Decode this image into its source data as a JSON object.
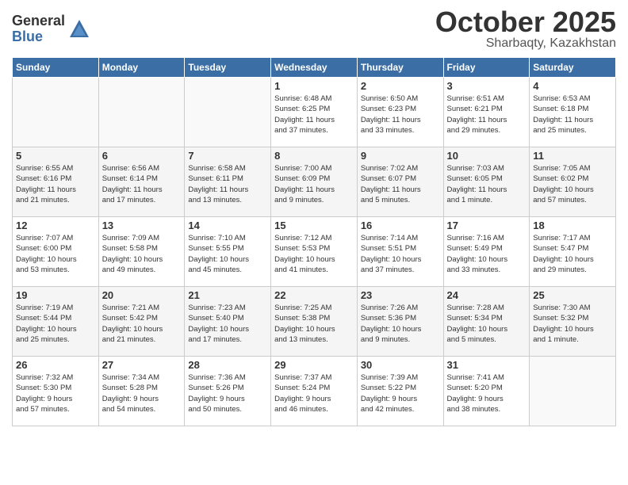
{
  "logo": {
    "general": "General",
    "blue": "Blue"
  },
  "header": {
    "month": "October 2025",
    "location": "Sharbaqty, Kazakhstan"
  },
  "weekdays": [
    "Sunday",
    "Monday",
    "Tuesday",
    "Wednesday",
    "Thursday",
    "Friday",
    "Saturday"
  ],
  "weeks": [
    [
      {
        "day": "",
        "info": ""
      },
      {
        "day": "",
        "info": ""
      },
      {
        "day": "",
        "info": ""
      },
      {
        "day": "1",
        "info": "Sunrise: 6:48 AM\nSunset: 6:25 PM\nDaylight: 11 hours\nand 37 minutes."
      },
      {
        "day": "2",
        "info": "Sunrise: 6:50 AM\nSunset: 6:23 PM\nDaylight: 11 hours\nand 33 minutes."
      },
      {
        "day": "3",
        "info": "Sunrise: 6:51 AM\nSunset: 6:21 PM\nDaylight: 11 hours\nand 29 minutes."
      },
      {
        "day": "4",
        "info": "Sunrise: 6:53 AM\nSunset: 6:18 PM\nDaylight: 11 hours\nand 25 minutes."
      }
    ],
    [
      {
        "day": "5",
        "info": "Sunrise: 6:55 AM\nSunset: 6:16 PM\nDaylight: 11 hours\nand 21 minutes."
      },
      {
        "day": "6",
        "info": "Sunrise: 6:56 AM\nSunset: 6:14 PM\nDaylight: 11 hours\nand 17 minutes."
      },
      {
        "day": "7",
        "info": "Sunrise: 6:58 AM\nSunset: 6:11 PM\nDaylight: 11 hours\nand 13 minutes."
      },
      {
        "day": "8",
        "info": "Sunrise: 7:00 AM\nSunset: 6:09 PM\nDaylight: 11 hours\nand 9 minutes."
      },
      {
        "day": "9",
        "info": "Sunrise: 7:02 AM\nSunset: 6:07 PM\nDaylight: 11 hours\nand 5 minutes."
      },
      {
        "day": "10",
        "info": "Sunrise: 7:03 AM\nSunset: 6:05 PM\nDaylight: 11 hours\nand 1 minute."
      },
      {
        "day": "11",
        "info": "Sunrise: 7:05 AM\nSunset: 6:02 PM\nDaylight: 10 hours\nand 57 minutes."
      }
    ],
    [
      {
        "day": "12",
        "info": "Sunrise: 7:07 AM\nSunset: 6:00 PM\nDaylight: 10 hours\nand 53 minutes."
      },
      {
        "day": "13",
        "info": "Sunrise: 7:09 AM\nSunset: 5:58 PM\nDaylight: 10 hours\nand 49 minutes."
      },
      {
        "day": "14",
        "info": "Sunrise: 7:10 AM\nSunset: 5:55 PM\nDaylight: 10 hours\nand 45 minutes."
      },
      {
        "day": "15",
        "info": "Sunrise: 7:12 AM\nSunset: 5:53 PM\nDaylight: 10 hours\nand 41 minutes."
      },
      {
        "day": "16",
        "info": "Sunrise: 7:14 AM\nSunset: 5:51 PM\nDaylight: 10 hours\nand 37 minutes."
      },
      {
        "day": "17",
        "info": "Sunrise: 7:16 AM\nSunset: 5:49 PM\nDaylight: 10 hours\nand 33 minutes."
      },
      {
        "day": "18",
        "info": "Sunrise: 7:17 AM\nSunset: 5:47 PM\nDaylight: 10 hours\nand 29 minutes."
      }
    ],
    [
      {
        "day": "19",
        "info": "Sunrise: 7:19 AM\nSunset: 5:44 PM\nDaylight: 10 hours\nand 25 minutes."
      },
      {
        "day": "20",
        "info": "Sunrise: 7:21 AM\nSunset: 5:42 PM\nDaylight: 10 hours\nand 21 minutes."
      },
      {
        "day": "21",
        "info": "Sunrise: 7:23 AM\nSunset: 5:40 PM\nDaylight: 10 hours\nand 17 minutes."
      },
      {
        "day": "22",
        "info": "Sunrise: 7:25 AM\nSunset: 5:38 PM\nDaylight: 10 hours\nand 13 minutes."
      },
      {
        "day": "23",
        "info": "Sunrise: 7:26 AM\nSunset: 5:36 PM\nDaylight: 10 hours\nand 9 minutes."
      },
      {
        "day": "24",
        "info": "Sunrise: 7:28 AM\nSunset: 5:34 PM\nDaylight: 10 hours\nand 5 minutes."
      },
      {
        "day": "25",
        "info": "Sunrise: 7:30 AM\nSunset: 5:32 PM\nDaylight: 10 hours\nand 1 minute."
      }
    ],
    [
      {
        "day": "26",
        "info": "Sunrise: 7:32 AM\nSunset: 5:30 PM\nDaylight: 9 hours\nand 57 minutes."
      },
      {
        "day": "27",
        "info": "Sunrise: 7:34 AM\nSunset: 5:28 PM\nDaylight: 9 hours\nand 54 minutes."
      },
      {
        "day": "28",
        "info": "Sunrise: 7:36 AM\nSunset: 5:26 PM\nDaylight: 9 hours\nand 50 minutes."
      },
      {
        "day": "29",
        "info": "Sunrise: 7:37 AM\nSunset: 5:24 PM\nDaylight: 9 hours\nand 46 minutes."
      },
      {
        "day": "30",
        "info": "Sunrise: 7:39 AM\nSunset: 5:22 PM\nDaylight: 9 hours\nand 42 minutes."
      },
      {
        "day": "31",
        "info": "Sunrise: 7:41 AM\nSunset: 5:20 PM\nDaylight: 9 hours\nand 38 minutes."
      },
      {
        "day": "",
        "info": ""
      }
    ]
  ]
}
